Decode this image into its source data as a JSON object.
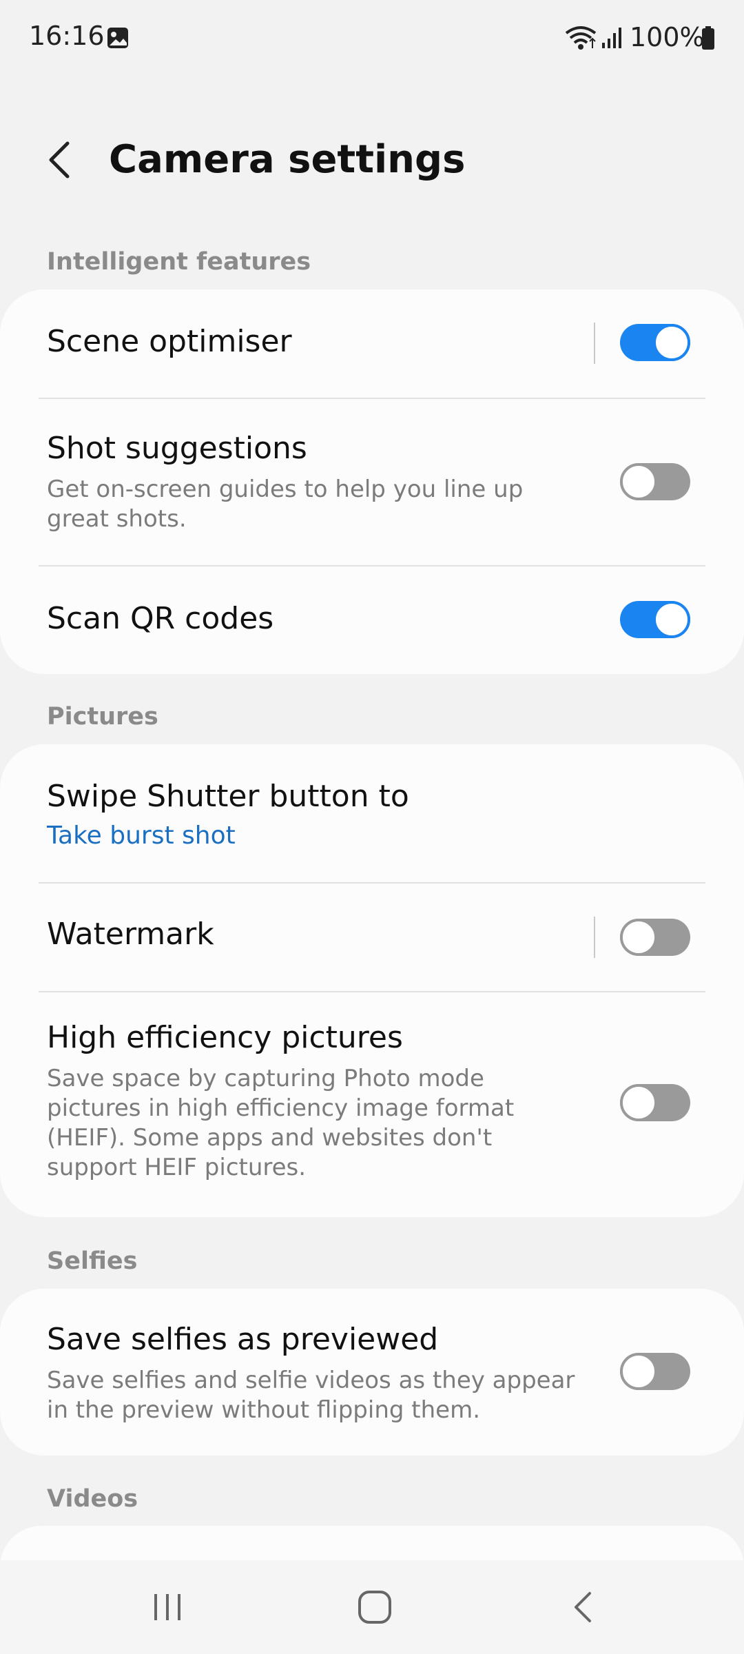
{
  "status_bar": {
    "time": "16:16",
    "battery": "100%"
  },
  "header": {
    "title": "Camera settings"
  },
  "sections": {
    "intelligent": {
      "label": "Intelligent features",
      "scene_optimiser": {
        "title": "Scene optimiser",
        "enabled": true
      },
      "shot_suggestions": {
        "title": "Shot suggestions",
        "subtitle": "Get on-screen guides to help you line up great shots.",
        "enabled": false
      },
      "scan_qr": {
        "title": "Scan QR codes",
        "enabled": true
      }
    },
    "pictures": {
      "label": "Pictures",
      "swipe_shutter": {
        "title": "Swipe Shutter button to",
        "value": "Take burst shot"
      },
      "watermark": {
        "title": "Watermark",
        "enabled": false
      },
      "high_efficiency": {
        "title": "High efficiency pictures",
        "subtitle": "Save space by capturing Photo mode pictures in high efficiency image format (HEIF). Some apps and websites don't support HEIF pictures.",
        "enabled": false
      }
    },
    "selfies": {
      "label": "Selfies",
      "save_selfies": {
        "title": "Save selfies as previewed",
        "subtitle": "Save selfies and selfie videos as they appear in the preview without flipping them.",
        "enabled": false
      }
    },
    "videos": {
      "label": "Videos"
    }
  },
  "colors": {
    "accent": "#1a84f0",
    "link": "#1a6fc1",
    "background": "#f2f2f2",
    "card": "#fcfcfc"
  },
  "icons": {
    "status_bar": [
      "gallery-icon",
      "wifi-icon",
      "signal-icon",
      "battery-icon"
    ],
    "header": [
      "back-arrow-icon"
    ],
    "navbar": [
      "recents-icon",
      "home-icon",
      "back-icon"
    ]
  }
}
